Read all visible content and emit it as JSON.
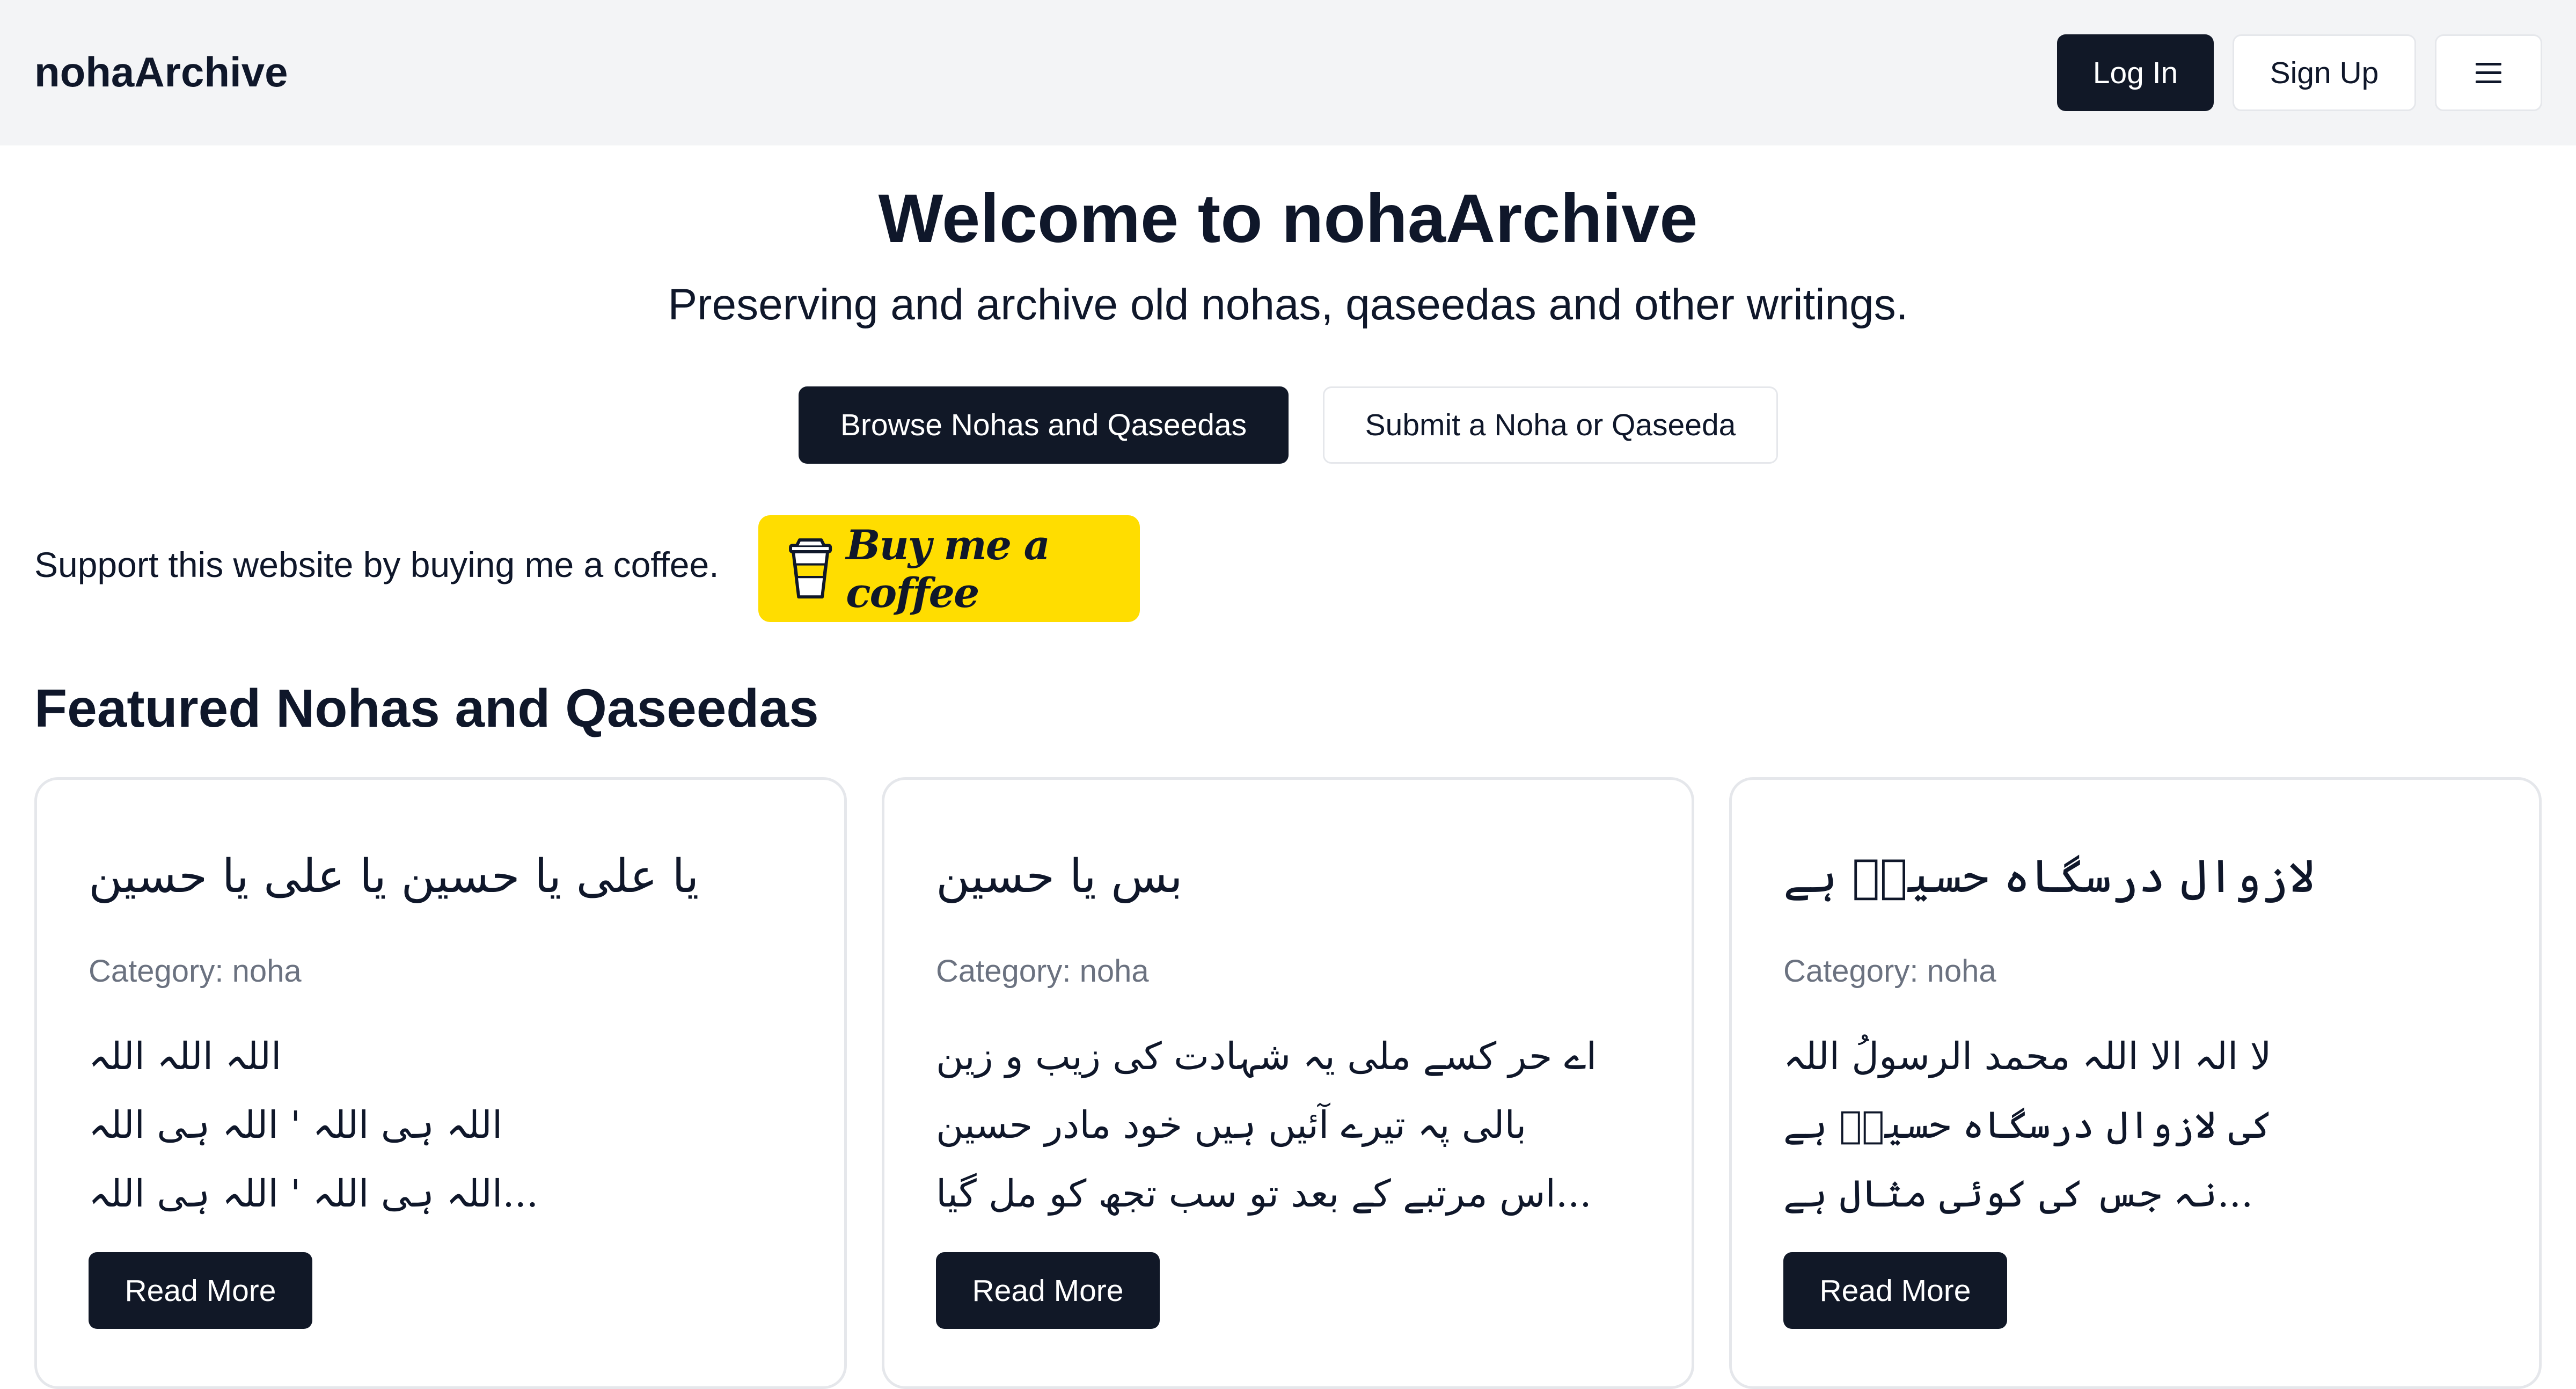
{
  "header": {
    "brand": "nohaArchive",
    "login_label": "Log In",
    "signup_label": "Sign Up",
    "menu_icon": "menu-icon"
  },
  "hero": {
    "title": "Welcome to nohaArchive",
    "subtitle": "Preserving and archive old nohas, qaseedas and other writings.",
    "browse_label": "Browse Nohas and Qaseedas",
    "submit_label": "Submit a Noha or Qaseeda"
  },
  "support": {
    "text": "Support this website by buying me a coffee.",
    "button_label": "Buy me a coffee",
    "button_color": "#ffdd00"
  },
  "featured": {
    "title": "Featured Nohas and Qaseedas",
    "cards": [
      {
        "title": "یا علی یا حسین یا علی یا حسین",
        "category": "Category: noha",
        "lines": [
          "اللہ اللہ اللہ",
          "اللہ ہی اللہ ' اللہ ہی اللہ",
          "...اللہ ہی اللہ ' اللہ ہی اللہ"
        ],
        "read_more": "Read More"
      },
      {
        "title": "بس یا حسین",
        "category": "Category: noha",
        "lines": [
          "اے حر کسے ملی یہ شہادت کی زیب و زین",
          "بالی پہ تیرے آئیں ہیں خود مادر حسین",
          "...اس مرتبے کے بعد تو سب تجھ کو مل گیا"
        ],
        "read_more": "Read More"
      },
      {
        "title": "لازوال درسگاہ حسینؑ ہے",
        "category": "Category: noha",
        "lines": [
          "لا الہ الا اللہ محمد الرسولُ اللہ",
          "کی لازوال درسگاہ حسینؑ ہے",
          "...نہ جس کی کوئی مثال ہے"
        ],
        "read_more": "Read More"
      }
    ]
  },
  "colors": {
    "primary": "#111827",
    "header_bg": "#f3f4f6",
    "muted_text": "#6b7280",
    "border": "#e5e7eb"
  }
}
